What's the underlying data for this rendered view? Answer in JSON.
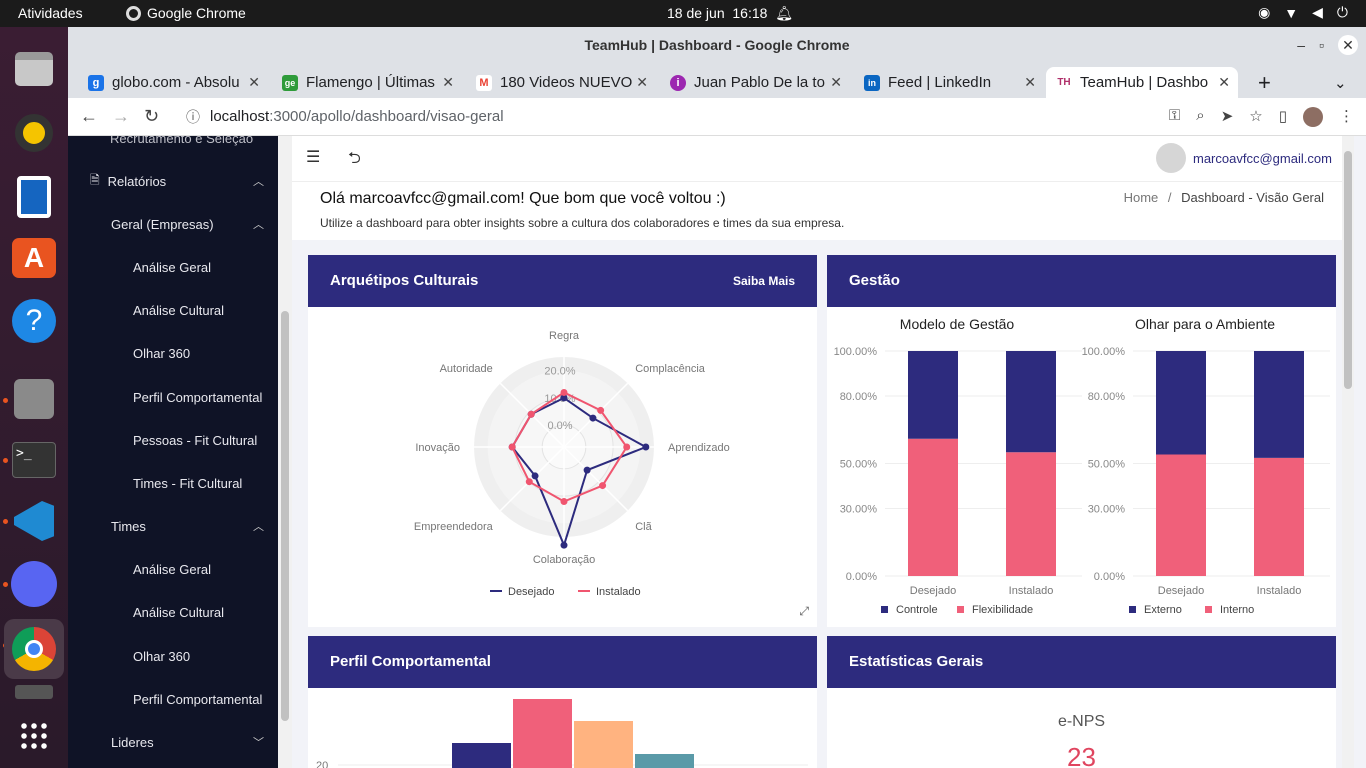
{
  "os": {
    "activities": "Atividades",
    "app_name": "Google Chrome",
    "clock_date": "18 de jun",
    "clock_time": "16:18"
  },
  "window": {
    "title": "TeamHub | Dashboard - Google Chrome"
  },
  "tabs": [
    {
      "label": "globo.com - Absolu",
      "favicon": "g",
      "color": "#1a73e8"
    },
    {
      "label": "Flamengo | Últimas",
      "favicon": "ge",
      "color": "#2e9b3a"
    },
    {
      "label": "180 Videos NUEVO",
      "favicon": "M",
      "color": "#ea4335"
    },
    {
      "label": "Juan Pablo De la to",
      "favicon": "i",
      "color": "#9c27b0"
    },
    {
      "label": "Feed | LinkedIn",
      "favicon": "in",
      "color": "#0a66c2"
    },
    {
      "label": "TeamHub | Dashbo",
      "favicon": "TH",
      "color": "#b0306a"
    }
  ],
  "url": {
    "host": "localhost",
    "path": ":3000/apollo/dashboard/visao-geral"
  },
  "sidebar": {
    "partial_top": "Recrutamento e Seleção",
    "relatorios": "Relatórios",
    "geral_group": "Geral (Empresas)",
    "geral_items": [
      "Análise Geral",
      "Análise Cultural",
      "Olhar 360",
      "Perfil Comportamental",
      "Pessoas - Fit Cultural",
      "Times - Fit Cultural"
    ],
    "times_group": "Times",
    "times_items": [
      "Análise Geral",
      "Análise Cultural",
      "Olhar 360",
      "Perfil Comportamental"
    ],
    "lideres": "Lideres"
  },
  "header": {
    "user_email": "marcoavfcc@gmail.com"
  },
  "greeting": {
    "title": "Olá marcoavfcc@gmail.com! Que bom que você voltou :)",
    "subtitle": "Utilize a dashboard para obter insights sobre a cultura dos colaboradores e times da sua empresa.",
    "breadcrumb_home": "Home",
    "breadcrumb_sep": "/",
    "breadcrumb_current": "Dashboard - Visão Geral"
  },
  "cards": {
    "arquetipos": {
      "title": "Arquétipos Culturais",
      "action": "Saiba Mais"
    },
    "gestao": {
      "title": "Gestão"
    },
    "perfil": {
      "title": "Perfil Comportamental"
    },
    "estatisticas": {
      "title": "Estatísticas Gerais",
      "enps_label": "e-NPS",
      "enps_value": "23"
    }
  },
  "chart_data": [
    {
      "type": "radar",
      "axes": [
        "Regra",
        "Complacência",
        "Aprendizado",
        "Clã",
        "Colaboração",
        "Empreendedora",
        "Inovação",
        "Autoridade"
      ],
      "tick_labels": [
        "0.0%",
        "10.0%",
        "20.0%"
      ],
      "series": [
        {
          "name": "Desejado",
          "color": "#2d2b7e",
          "values": [
            10,
            7,
            22,
            4,
            28,
            7,
            11,
            9
          ]
        },
        {
          "name": "Instalado",
          "color": "#f0556f",
          "values": [
            12,
            11,
            15,
            12,
            12,
            10,
            11,
            9
          ]
        }
      ],
      "ylim": [
        -8,
        25
      ]
    },
    {
      "type": "bar",
      "stacked": true,
      "title": "Modelo de Gestão",
      "categories": [
        "Desejado",
        "Instalado"
      ],
      "yticks": [
        "0.00%",
        "30.00%",
        "50.00%",
        "80.00%",
        "100.00%"
      ],
      "series": [
        {
          "name": "Controle",
          "color": "#2d2b7e",
          "values": [
            39,
            45
          ]
        },
        {
          "name": "Flexibilidade",
          "color": "#f0607a",
          "values": [
            61,
            55
          ]
        }
      ]
    },
    {
      "type": "bar",
      "stacked": true,
      "title": "Olhar para o Ambiente",
      "categories": [
        "Desejado",
        "Instalado"
      ],
      "yticks": [
        "0.00%",
        "30.00%",
        "50.00%",
        "80.00%",
        "100.00%"
      ],
      "series": [
        {
          "name": "Externo",
          "color": "#2d2b7e",
          "values": [
            46,
            47.5
          ]
        },
        {
          "name": "Interno",
          "color": "#f0607a",
          "values": [
            54,
            52.5
          ]
        }
      ]
    },
    {
      "type": "bar",
      "title": "",
      "ytick_visible": "20",
      "values": [
        22,
        26,
        24,
        21
      ],
      "colors": [
        "#2d2b7e",
        "#f0607a",
        "#ffb380",
        "#5a9aa8"
      ],
      "ylim": [
        19,
        27
      ]
    }
  ]
}
